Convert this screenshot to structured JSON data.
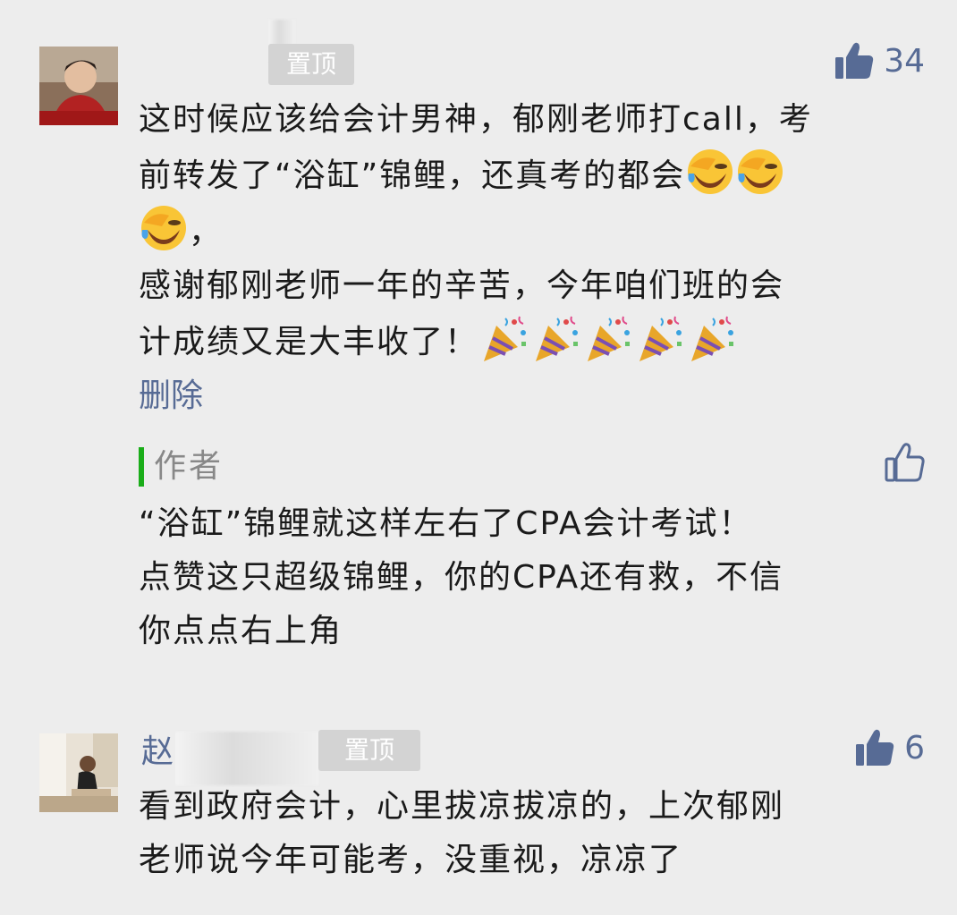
{
  "comments": [
    {
      "pin_label": "置顶",
      "like_count": "34",
      "text_line1": "这时候应该给会计男神，郁刚老师打call，考",
      "text_line2a": "前转发了“浴缸”锦鲤，还真考的都会",
      "text_line3b": "，",
      "text_line4": "感谢郁刚老师一年的辛苦，今年咱们班的会",
      "text_line5": "计成绩又是大丰收了！",
      "delete_label": "删除",
      "author_reply": {
        "label": "作者",
        "line1": "“浴缸”锦鲤就这样左右了CPA会计考试！",
        "line2": "点赞这只超级锦鲤，你的CPA还有救，不信",
        "line3": "你点点右上角"
      }
    },
    {
      "name_first_char": "赵",
      "pin_label": "置顶",
      "like_count": "6",
      "line1": "看到政府会计，心里拔凉拔凉的，上次郁刚",
      "line2": "老师说今年可能考，没重视，凉凉了"
    }
  ],
  "colors": {
    "background": "#ededed",
    "link": "#576b95",
    "author_bar": "#1aad19",
    "pin_badge": "#d3d3d3"
  },
  "icons": [
    "thumbs-up-filled-icon",
    "thumbs-up-outline-icon",
    "face-palm-emoji",
    "party-popper-emoji"
  ]
}
